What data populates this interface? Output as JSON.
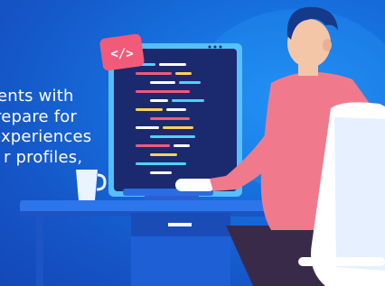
{
  "overlay_text": {
    "line1": "ents with",
    "line2": "repare for",
    "line3": "experiences",
    "line4": "r profiles,"
  },
  "code_badge": {
    "glyph": "</>"
  },
  "colors": {
    "background": "#1670de",
    "monitor_screen": "#1b2a6e",
    "shirt": "#f07a8c",
    "hair": "#153a8a",
    "desk": "#2a6ae0",
    "chair": "#ffffff",
    "badge": "#f25a7a"
  }
}
